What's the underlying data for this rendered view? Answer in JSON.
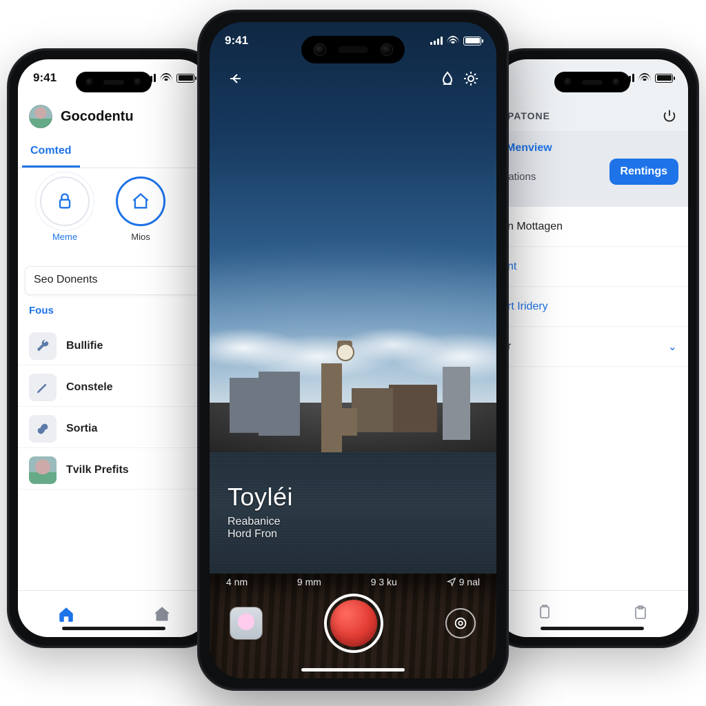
{
  "status": {
    "time": "9:41"
  },
  "left": {
    "title": "Gocodentu",
    "tab": "Comted",
    "circles": [
      {
        "label": "Meme"
      },
      {
        "label": "Mios"
      }
    ],
    "category_strip": "Seo Donents",
    "subheader": "Fous",
    "items": [
      {
        "label": "Bullifie"
      },
      {
        "label": "Constele"
      },
      {
        "label": "Sortia"
      },
      {
        "label": "Tvilk Prefits"
      }
    ]
  },
  "center": {
    "title": "Toyléi",
    "sub1": "Reabanice",
    "sub2": "Hord Fron",
    "metrics": [
      {
        "v": "4 nm"
      },
      {
        "v": "9 mm"
      },
      {
        "v": "9 3 ku"
      },
      {
        "v": "9 nal"
      }
    ]
  },
  "right": {
    "brand": "PATONE",
    "tab_a": "Menview",
    "tab_b": "lations",
    "cta": "Rentings",
    "items": [
      {
        "label": "n Mottagen",
        "link": false,
        "chevron": false
      },
      {
        "label": "nt",
        "link": true,
        "chevron": false
      },
      {
        "label": "rt Iridery",
        "link": true,
        "chevron": false
      },
      {
        "label": "r",
        "link": false,
        "chevron": true
      }
    ]
  }
}
